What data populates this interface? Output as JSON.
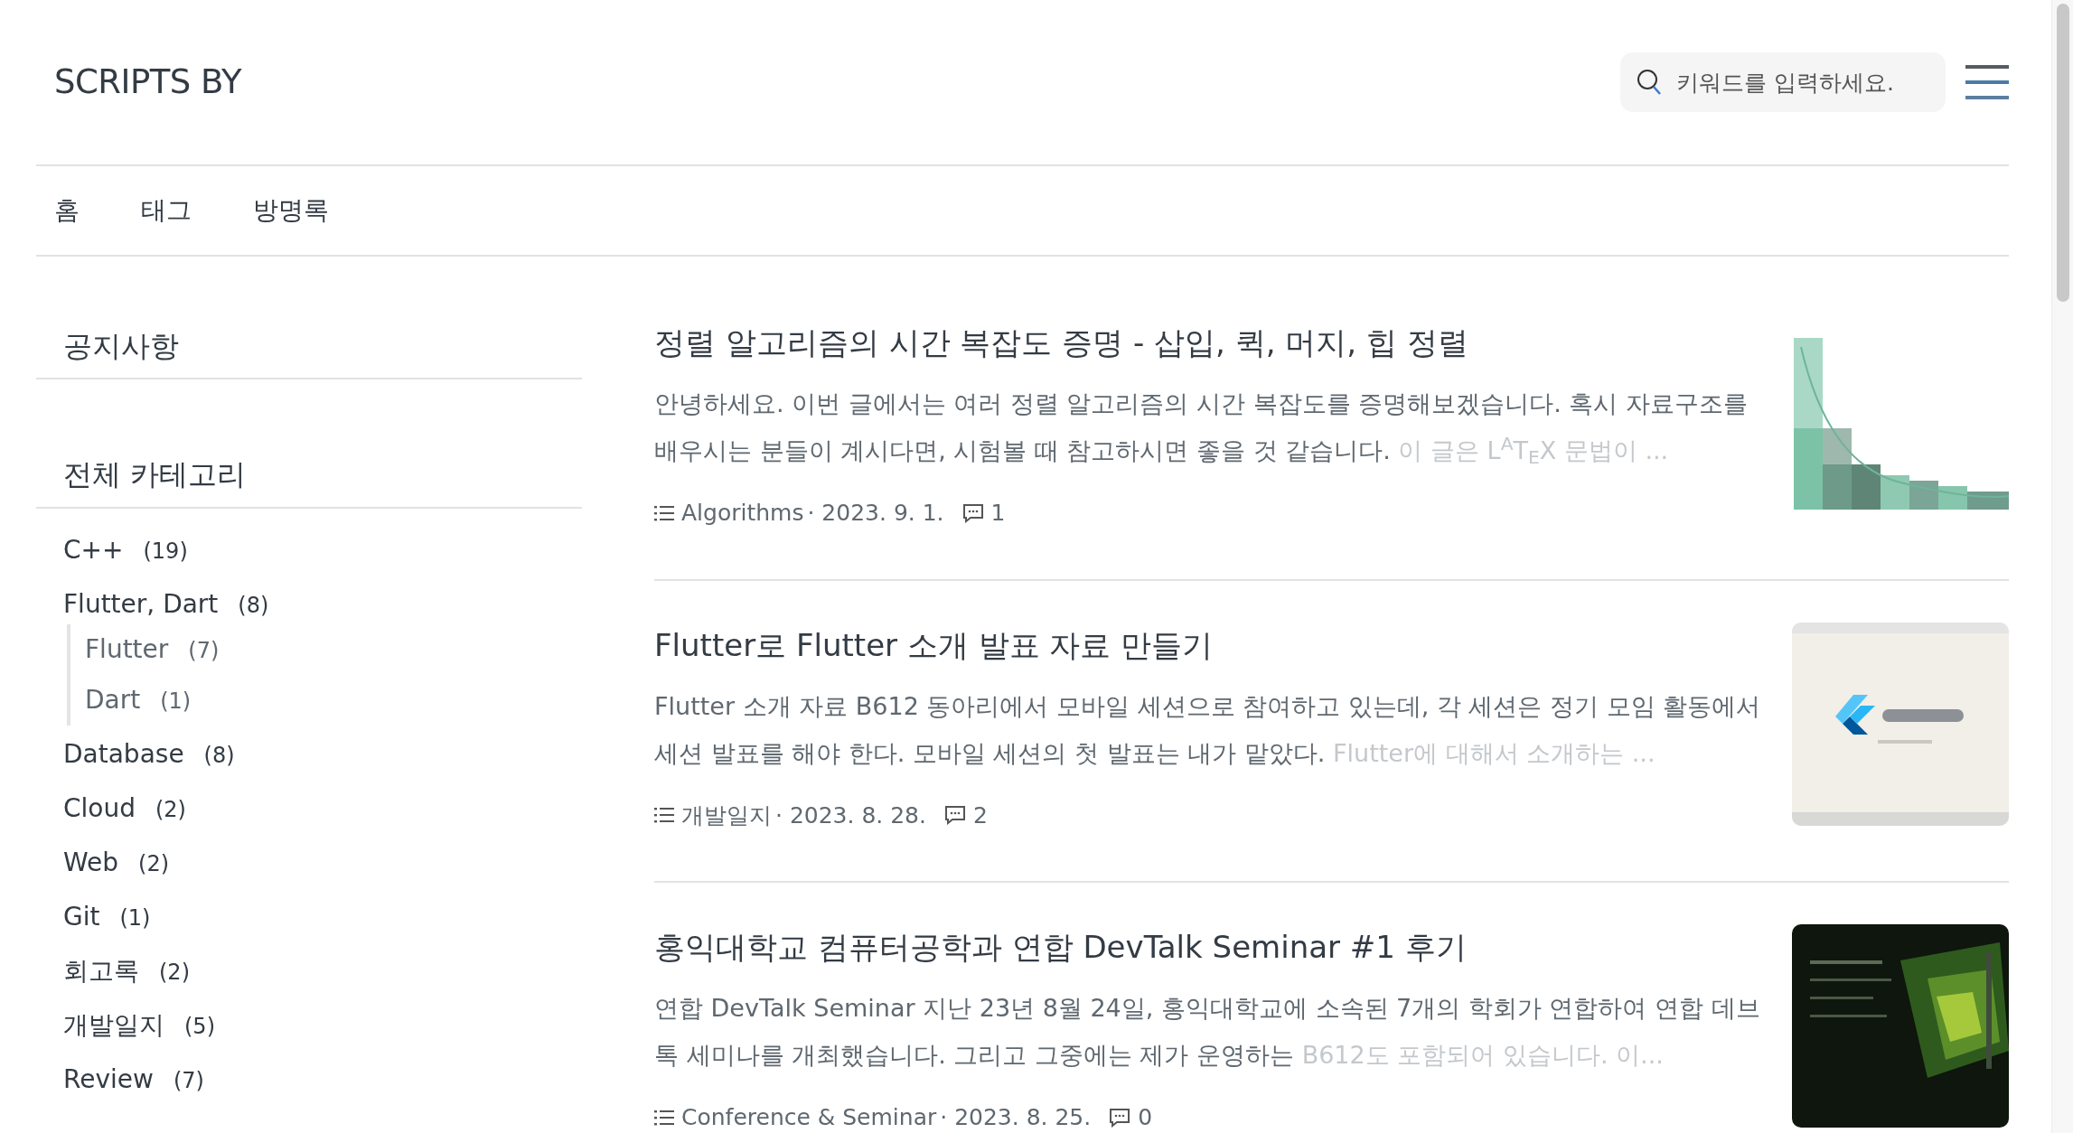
{
  "header": {
    "logo": "SCRIPTS BY",
    "search": {
      "placeholder": "키워드를 입력하세요."
    }
  },
  "nav": [
    {
      "label": "홈"
    },
    {
      "label": "태그"
    },
    {
      "label": "방명록"
    }
  ],
  "sidebar": {
    "notice_title": "공지사항",
    "category_title": "전체 카테고리",
    "categories": [
      {
        "name": "C++",
        "count": "(19)"
      },
      {
        "name": "Flutter, Dart",
        "count": "(8)",
        "children": [
          {
            "name": "Flutter",
            "count": "(7)"
          },
          {
            "name": "Dart",
            "count": "(1)"
          }
        ]
      },
      {
        "name": "Database",
        "count": "(8)"
      },
      {
        "name": "Cloud",
        "count": "(2)"
      },
      {
        "name": "Web",
        "count": "(2)"
      },
      {
        "name": "Git",
        "count": "(1)"
      },
      {
        "name": "회고록",
        "count": "(2)"
      },
      {
        "name": "개발일지",
        "count": "(5)"
      },
      {
        "name": "Review",
        "count": "(7)"
      }
    ]
  },
  "posts": [
    {
      "title": "정렬 알고리즘의 시간 복잡도 증명 - 삽입, 퀵, 머지, 힙 정렬",
      "excerpt": "안녕하세요. 이번 글에서는 여러 정렬 알고리즘의 시간 복잡도를 증명해보겠습니다. 혹시 자료구조를 배우시는 분들이 계시다면, 시험볼 때 참고하시면 좋을 것 같습니다.",
      "excerpt_faded": "이 글은 L$^{A}$T$_{E}$X 문법이 ...",
      "category": "Algorithms",
      "date": "· 2023. 9. 1.",
      "comments": "1"
    },
    {
      "title": "Flutter로 Flutter 소개 발표 자료 만들기",
      "excerpt": "Flutter 소개 자료 B612 동아리에서 모바일 세션으로 참여하고 있는데, 각 세션은 정기 모임 활동에서 세션 발표를 해야 한다. 모바일 세션의 첫 발표는 내가 맡았다.",
      "excerpt_faded": "Flutter에 대해서 소개하는 ...",
      "category": "개발일지",
      "date": "· 2023. 8. 28.",
      "comments": "2"
    },
    {
      "title": "홍익대학교 컴퓨터공학과 연합 DevTalk Seminar #1 후기",
      "excerpt": "연합 DevTalk Seminar 지난 23년 8월 24일, 홍익대학교에 소속된 7개의 학회가 연합하여 연합 데브톡 세미나를 개최했습니다. 그리고 그중에는 제가 운영하는",
      "excerpt_faded": "B612도 포함되어 있습니다. 이...",
      "category": "Conference & Seminar",
      "date": "· 2023. 8. 25.",
      "comments": "0"
    }
  ]
}
